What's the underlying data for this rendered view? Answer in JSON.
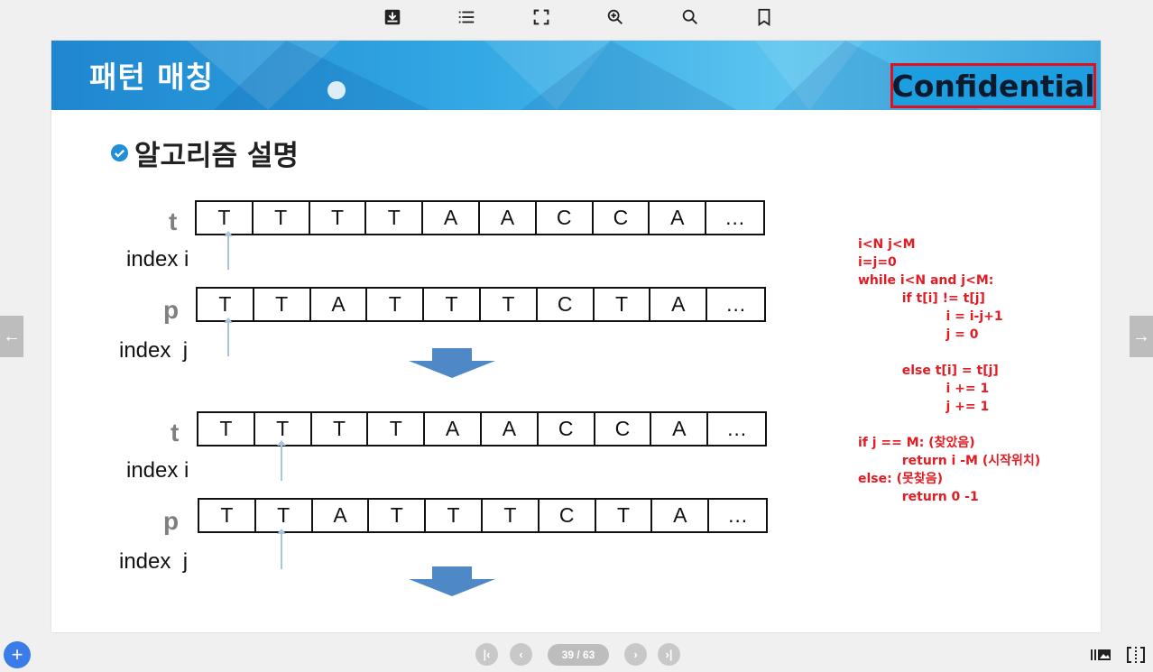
{
  "toolbar": {
    "icons": [
      "download-icon",
      "list-icon",
      "fullscreen-icon",
      "zoom-in-icon",
      "search-icon",
      "bookmark-icon"
    ]
  },
  "slide": {
    "title": "패턴 매칭",
    "confidential": "Confidential",
    "section_title": "알고리즘 설명",
    "block1": {
      "t_label": "t",
      "t_cells": [
        "T",
        "T",
        "T",
        "T",
        "A",
        "A",
        "C",
        "C",
        "A",
        "…"
      ],
      "index_i": "index i",
      "p_label": "p",
      "p_cells": [
        "T",
        "T",
        "A",
        "T",
        "T",
        "T",
        "C",
        "T",
        "A",
        "…"
      ],
      "index_j": "index  j"
    },
    "block2": {
      "t_label": "t",
      "t_cells": [
        "T",
        "T",
        "T",
        "T",
        "A",
        "A",
        "C",
        "C",
        "A",
        "…"
      ],
      "index_i": "index i",
      "p_label": "p",
      "p_cells": [
        "T",
        "T",
        "A",
        "T",
        "T",
        "T",
        "C",
        "T",
        "A",
        "…"
      ],
      "index_j": "index  j"
    },
    "code_lines": [
      "i<N j<M",
      "i=j=0",
      "while i<N and j<M:",
      "          if t[i] != t[j]",
      "                    i = i-j+1",
      "                    j = 0",
      "",
      "          else t[i] = t[j]",
      "                    i += 1",
      "                    j += 1",
      "",
      "if j == M: (찾았음)",
      "          return i -M (시작위치)",
      "else: (못찾음)",
      "          return 0 -1"
    ],
    "colors": {
      "banner": "#2a9fe0",
      "code": "#e31b23",
      "confidential_border": "#e0101f"
    }
  },
  "nav": {
    "prev": "←",
    "next": "→"
  },
  "pager": {
    "first": "|‹",
    "prev": "‹",
    "page_text": "39 / 63",
    "next": "›",
    "last": "›|"
  },
  "fab": "+"
}
